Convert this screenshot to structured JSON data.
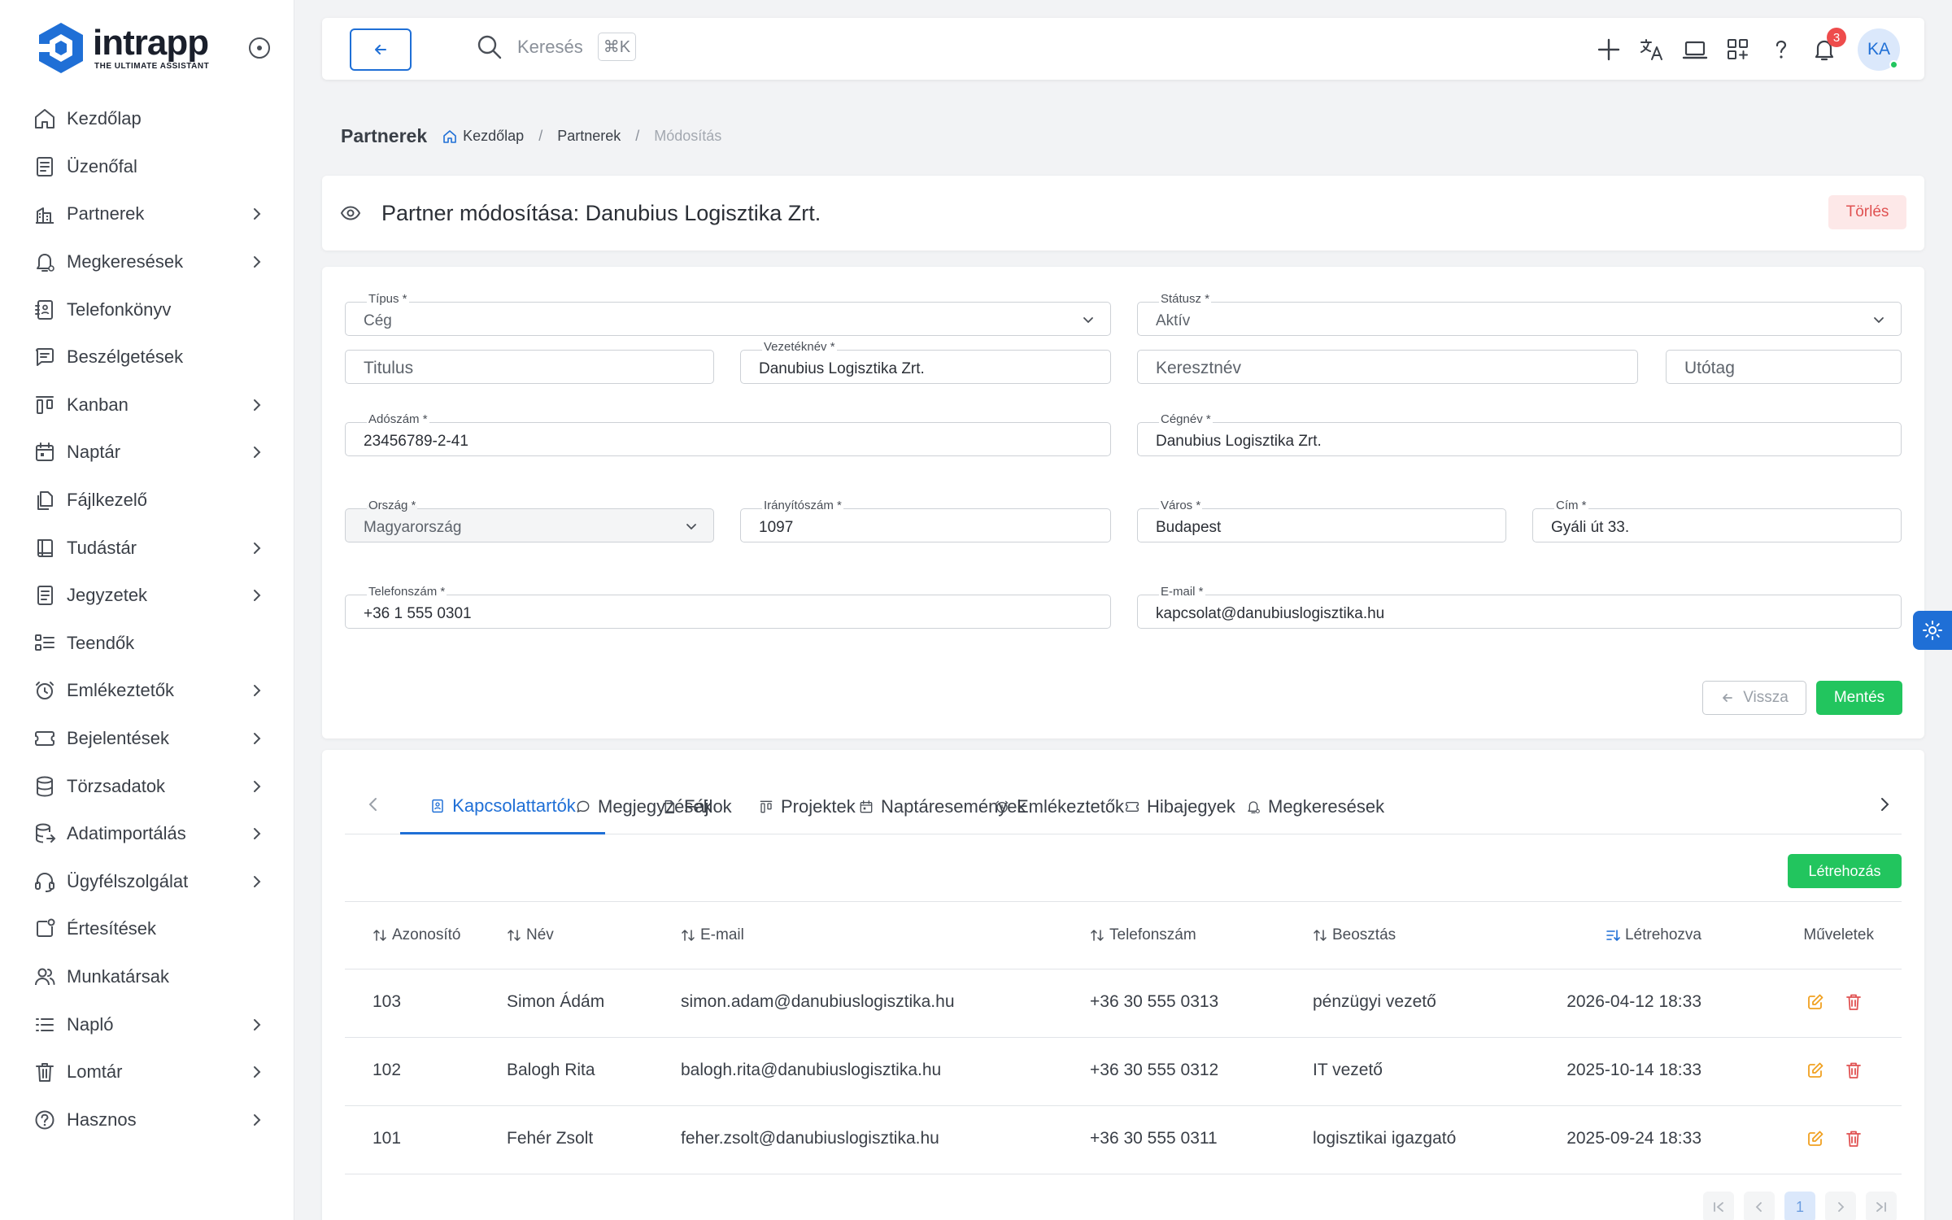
{
  "brand": {
    "name": "intrapp",
    "tagline": "THE ULTIMATE ASSISTANT",
    "accent": "#1f6fd6"
  },
  "sidebar": {
    "items": [
      {
        "label": "Kezdőlap",
        "icon": "home-icon",
        "has_children": false
      },
      {
        "label": "Üzenőfal",
        "icon": "message-board-icon",
        "has_children": false
      },
      {
        "label": "Partnerek",
        "icon": "partners-icon",
        "has_children": true
      },
      {
        "label": "Megkeresések",
        "icon": "bell-dollar-icon",
        "has_children": true
      },
      {
        "label": "Telefonkönyv",
        "icon": "phonebook-icon",
        "has_children": false
      },
      {
        "label": "Beszélgetések",
        "icon": "chat-icon",
        "has_children": false
      },
      {
        "label": "Kanban",
        "icon": "kanban-icon",
        "has_children": true
      },
      {
        "label": "Naptár",
        "icon": "calendar-icon",
        "has_children": true
      },
      {
        "label": "Fájlkezelő",
        "icon": "files-icon",
        "has_children": false
      },
      {
        "label": "Tudástár",
        "icon": "book-icon",
        "has_children": true
      },
      {
        "label": "Jegyzetek",
        "icon": "notes-icon",
        "has_children": true
      },
      {
        "label": "Teendők",
        "icon": "todo-list-icon",
        "has_children": false
      },
      {
        "label": "Emlékeztetők",
        "icon": "alarm-icon",
        "has_children": true
      },
      {
        "label": "Bejelentések",
        "icon": "ticket-icon",
        "has_children": true
      },
      {
        "label": "Törzsadatok",
        "icon": "database-icon",
        "has_children": true
      },
      {
        "label": "Adatimportálás",
        "icon": "database-import-icon",
        "has_children": true
      },
      {
        "label": "Ügyfélszolgálat",
        "icon": "headset-icon",
        "has_children": true
      },
      {
        "label": "Értesítések",
        "icon": "notification-icon",
        "has_children": false
      },
      {
        "label": "Munkatársak",
        "icon": "users-icon",
        "has_children": false
      },
      {
        "label": "Napló",
        "icon": "log-list-icon",
        "has_children": true
      },
      {
        "label": "Lomtár",
        "icon": "trash-icon",
        "has_children": true
      },
      {
        "label": "Hasznos",
        "icon": "help-circle-icon",
        "has_children": true
      }
    ]
  },
  "topbar": {
    "search_label": "Keresés",
    "search_shortcut": "⌘K",
    "notifications_count": "3",
    "avatar_initials": "KA"
  },
  "breadcrumb": {
    "section": "Partnerek",
    "items": [
      "Kezdőlap",
      "Partnerek"
    ],
    "current": "Módosítás"
  },
  "header": {
    "title": "Partner módosítása: Danubius Logisztika Zrt.",
    "delete_label": "Törlés"
  },
  "form": {
    "type": {
      "label": "Típus *",
      "value": "Cég"
    },
    "status": {
      "label": "Státusz *",
      "value": "Aktív"
    },
    "title_field": {
      "placeholder": "Titulus"
    },
    "last_name": {
      "label": "Vezetéknév *",
      "value": "Danubius Logisztika Zrt."
    },
    "first_name": {
      "placeholder": "Keresztnév"
    },
    "suffix": {
      "placeholder": "Utótag"
    },
    "tax_number": {
      "label": "Adószám *",
      "value": "23456789-2-41"
    },
    "company_name": {
      "label": "Cégnév *",
      "value": "Danubius Logisztika Zrt."
    },
    "country": {
      "label": "Ország *",
      "value": "Magyarország"
    },
    "zip": {
      "label": "Irányítószám *",
      "value": "1097"
    },
    "city": {
      "label": "Város *",
      "value": "Budapest"
    },
    "address": {
      "label": "Cím *",
      "value": "Gyáli út 33."
    },
    "phone": {
      "label": "Telefonszám *",
      "value": "+36 1 555 0301"
    },
    "email": {
      "label": "E-mail *",
      "value": "kapcsolat@danubiuslogisztika.hu"
    },
    "back_label": "Vissza",
    "save_label": "Mentés"
  },
  "tabs": [
    {
      "label": "Kapcsolattartók",
      "icon": "contact-icon",
      "active": true
    },
    {
      "label": "Megjegyzések",
      "icon": "comment-icon",
      "active": false
    },
    {
      "label": "Fájlok",
      "icon": "file-icon",
      "active": false
    },
    {
      "label": "Projektek",
      "icon": "kanban-icon",
      "active": false
    },
    {
      "label": "Naptáresemények",
      "icon": "calendar-icon",
      "active": false
    },
    {
      "label": "Emlékeztetők",
      "icon": "alarm-icon",
      "active": false
    },
    {
      "label": "Hibajegyek",
      "icon": "ticket-icon",
      "active": false
    },
    {
      "label": "Megkeresések",
      "icon": "bell-dollar-icon",
      "active": false
    }
  ],
  "contacts": {
    "create_label": "Létrehozás",
    "columns": [
      "Azonosító",
      "Név",
      "E-mail",
      "Telefonszám",
      "Beosztás",
      "Létrehozva",
      "Műveletek"
    ],
    "rows": [
      {
        "id": "103",
        "name": "Simon Ádám",
        "email": "simon.adam@danubiuslogisztika.hu",
        "phone": "+36 30 555 0313",
        "position": "pénzügyi vezető",
        "created": "2026-04-12 18:33"
      },
      {
        "id": "102",
        "name": "Balogh Rita",
        "email": "balogh.rita@danubiuslogisztika.hu",
        "phone": "+36 30 555 0312",
        "position": "IT vezető",
        "created": "2025-10-14 18:33"
      },
      {
        "id": "101",
        "name": "Fehér Zsolt",
        "email": "feher.zsolt@danubiuslogisztika.hu",
        "phone": "+36 30 555 0311",
        "position": "logisztikai igazgató",
        "created": "2025-09-24 18:33"
      }
    ],
    "pager": {
      "current_page": "1"
    }
  },
  "colors": {
    "primary": "#1f6fd6",
    "success": "#22c55e",
    "danger": "#e05252",
    "edit": "#f0a020"
  }
}
